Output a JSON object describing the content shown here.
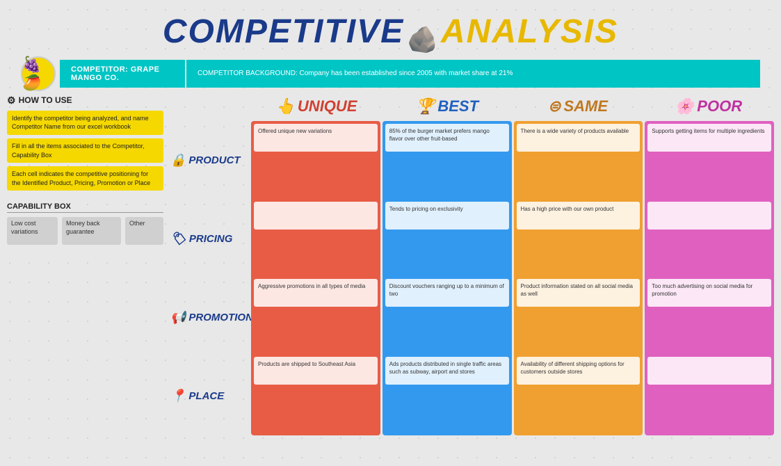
{
  "title": {
    "part1": "COMPETITIVE",
    "icon": "🪨",
    "part2": "ANALYSIS"
  },
  "competitor": {
    "logo_emoji": "🍇🥭",
    "name_label": "COMPETITOR: GRAPE MANGO CO.",
    "background_label": "COMPETITOR BACKGROUND: Company has been established since 2005 with market share at 21%"
  },
  "how_to_use": {
    "title": "HOW TO USE",
    "gear_icon": "⚙",
    "steps": [
      "Identify the competitor being analyzed, and name Competitor Name from our excel workbook",
      "Fill in all the items associated to the Competitor, Capability Box",
      "Each cell indicates the competitive positioning for the Identified Product, Pricing, Promotion or Place"
    ]
  },
  "capability_box": {
    "title": "CAPABILITY BOX",
    "boxes": [
      "Low cost variations",
      "Money back guarantee",
      "Other"
    ]
  },
  "columns": [
    {
      "id": "unique",
      "label": "UNIQUE",
      "icon": "👆",
      "class": "col-unique",
      "strip": "col-strip-unique"
    },
    {
      "id": "best",
      "label": "BEST",
      "icon": "🏆",
      "class": "col-best",
      "strip": "col-strip-best"
    },
    {
      "id": "same",
      "label": "SAME",
      "icon": "⊜",
      "class": "col-same",
      "strip": "col-strip-same"
    },
    {
      "id": "poor",
      "label": "POOR",
      "icon": "🌸",
      "class": "col-poor",
      "strip": "col-strip-poor"
    }
  ],
  "rows": [
    {
      "label": "PRODUCT",
      "icon": "🔒"
    },
    {
      "label": "PRICING",
      "icon": "🏷"
    },
    {
      "label": "PROMOTIONS",
      "icon": "📢"
    },
    {
      "label": "PLACE",
      "icon": "📍"
    }
  ],
  "cells": {
    "unique": {
      "product": "Offered unique new variations",
      "pricing": "",
      "promotions": "Aggressive promotions in all types of media",
      "place": "Products are shipped to Southeast Asia"
    },
    "best": {
      "product": "85% of the burger market prefers mango flavor over other fruit-based",
      "pricing": "Tends to pricing on exclusivity",
      "promotions": "Discount vouchers ranging up to a minimum of two",
      "place": "Ads products distributed in single traffic areas such as subway, airport and stores"
    },
    "same": {
      "product": "There is a wide variety of products available",
      "pricing": "Has a high price with our own product",
      "promotions": "Product information stated on all social media as well",
      "place": "Availability of different shipping options for customers outside stores"
    },
    "poor": {
      "product": "Supports getting items for multiple ingredients",
      "pricing": "",
      "promotions": "Too much advertising on social media for promotion",
      "place": ""
    }
  }
}
